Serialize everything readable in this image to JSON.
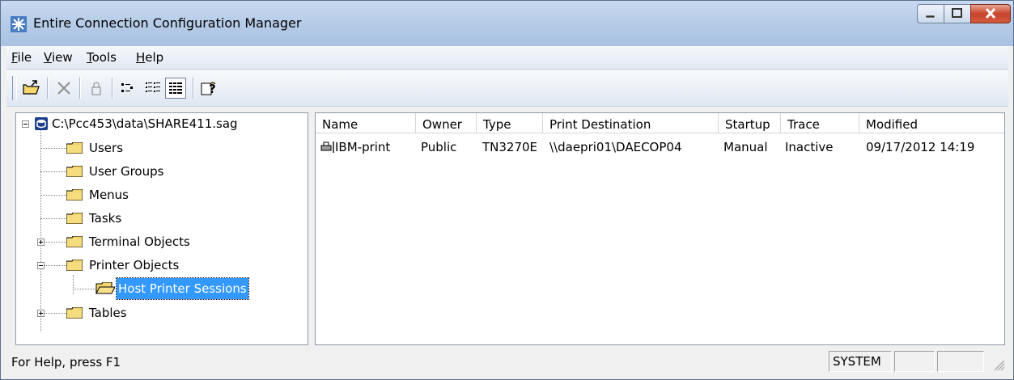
{
  "window": {
    "title": "Entire Connection Configuration Manager"
  },
  "menubar": {
    "items": [
      {
        "label_u": "F",
        "label_rest": "ile"
      },
      {
        "label_u": "V",
        "label_rest": "iew"
      },
      {
        "label_u": "T",
        "label_rest": "ools"
      },
      {
        "label_u": "H",
        "label_rest": "elp"
      }
    ]
  },
  "toolbar": {
    "buttons": [
      "open-folder-icon",
      "delete-x-icon",
      "lock-icon",
      "small-icons-view-icon",
      "list-view-icon",
      "details-view-icon",
      "help-icon"
    ],
    "active": "details-view-icon"
  },
  "tree": {
    "root": "C:\\Pcc453\\data\\SHARE411.sag",
    "items": [
      {
        "label": "Users"
      },
      {
        "label": "User Groups"
      },
      {
        "label": "Menus"
      },
      {
        "label": "Tasks"
      },
      {
        "label": "Terminal Objects"
      },
      {
        "label": "Printer Objects"
      },
      {
        "label": "Host Printer Sessions"
      },
      {
        "label": "Tables"
      }
    ],
    "selected": "Host Printer Sessions"
  },
  "list": {
    "columns": [
      "Name",
      "Owner",
      "Type",
      "Print Destination",
      "Startup",
      "Trace",
      "Modified"
    ],
    "rows": [
      {
        "name": "IBM-print",
        "owner": "Public",
        "type": "TN3270E",
        "print_destination": "\\\\daepri01\\DAECOP04",
        "startup": "Manual",
        "trace": "Inactive",
        "modified": "09/17/2012 14:19"
      }
    ]
  },
  "statusbar": {
    "help_text": "For Help, press F1",
    "user": "SYSTEM"
  },
  "colors": {
    "selection": "#3399ff",
    "titlebar": "#b7cde8",
    "close_button": "#c7432c"
  }
}
